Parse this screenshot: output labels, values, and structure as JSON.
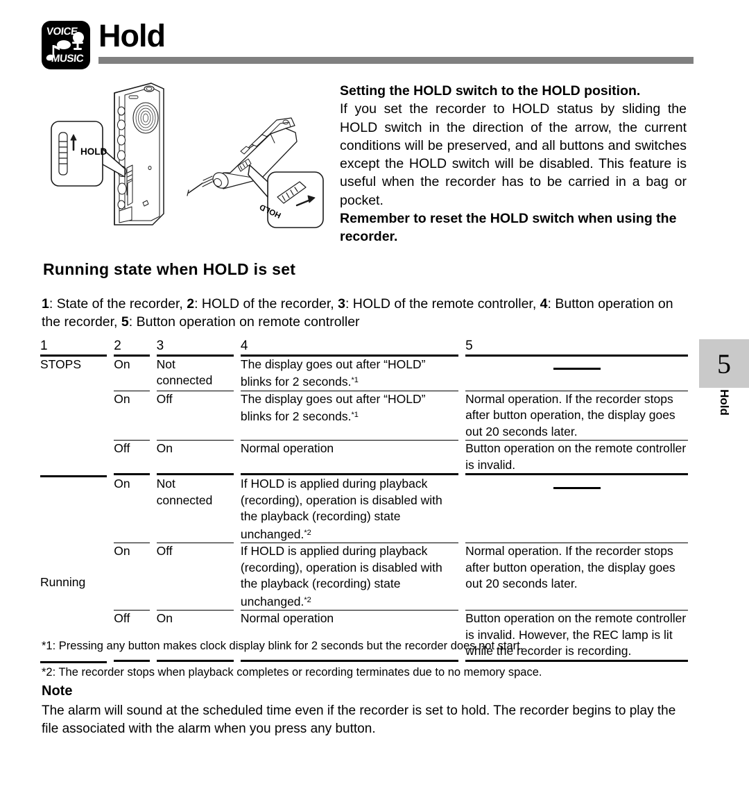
{
  "header": {
    "title": "Hold",
    "logo": {
      "top_text": "VOICE",
      "bottom_text": "MUSIC",
      "icon": "voice-music-logo"
    },
    "rule_color": "#808080"
  },
  "illustration": {
    "recorder_callout_label": "HOLD",
    "remote_callout_label": "HOLD",
    "alt": "IC recorder with HOLD switch callout and remote controller with HOLD switch callout"
  },
  "intro": {
    "heading": "Setting the HOLD switch to the HOLD position.",
    "body": "If you set the recorder to HOLD status by sliding the HOLD switch in the direction of the arrow, the current conditions will be preserved, and all buttons and switches except the HOLD switch will be disabled. This feature is useful when the recorder has to be carried in a bag or pocket.",
    "reminder": "Remember to reset the HOLD switch when using the recorder."
  },
  "section": {
    "heading": "Running state when HOLD is set",
    "legend_parts": [
      {
        "num": "1",
        "text": ": State of the recorder, "
      },
      {
        "num": "2",
        "text": ": HOLD of the recorder, "
      },
      {
        "num": "3",
        "text": ": HOLD of the remote controller, "
      },
      {
        "num": "4",
        "text": ": Button operation on the recorder, "
      },
      {
        "num": "5",
        "text": ": Button operation on remote controller"
      }
    ]
  },
  "table": {
    "headers": [
      "1",
      "2",
      "3",
      "4",
      "5"
    ],
    "groups": [
      {
        "state": "STOPS",
        "rows": [
          {
            "hold_recorder": "On",
            "hold_remote": "Not connected",
            "recorder_op": "The display goes out after “HOLD” blinks for 2 seconds.",
            "recorder_op_note": "*1",
            "remote_op": "",
            "remote_op_dash": true
          },
          {
            "hold_recorder": "On",
            "hold_remote": "Off",
            "recorder_op": "The display goes out after “HOLD” blinks for 2 seconds.",
            "recorder_op_note": "*1",
            "remote_op": "Normal operation. If the recorder stops after button operation, the display goes out 20 seconds later.",
            "remote_op_dash": false
          },
          {
            "hold_recorder": "Off",
            "hold_remote": "On",
            "recorder_op": "Normal operation",
            "recorder_op_note": "",
            "remote_op": "Button operation on the remote controller is invalid.",
            "remote_op_dash": false
          }
        ]
      },
      {
        "state": "Running",
        "rows": [
          {
            "hold_recorder": "On",
            "hold_remote": "Not connected",
            "recorder_op": "If HOLD is applied during playback (recording), operation is disabled with the playback (recording) state unchanged.",
            "recorder_op_note": "*2",
            "remote_op": "",
            "remote_op_dash": true
          },
          {
            "hold_recorder": "On",
            "hold_remote": "Off",
            "recorder_op": "If HOLD is applied during playback (recording), operation is disabled with the playback (recording) state unchanged.",
            "recorder_op_note": "*2",
            "remote_op": "Normal operation. If the recorder stops after button operation, the display goes out 20 seconds later.",
            "remote_op_dash": false
          },
          {
            "hold_recorder": "Off",
            "hold_remote": "On",
            "recorder_op": "Normal operation",
            "recorder_op_note": "",
            "remote_op": "Button operation on the remote controller is invalid. However, the REC lamp is lit while the recorder is recording.",
            "remote_op_dash": false
          }
        ]
      }
    ]
  },
  "footnotes": [
    "*1: Pressing any button makes clock display blink for 2 seconds but the recorder does not start.",
    "*2: The recorder stops when playback completes or recording terminates due to no memory space."
  ],
  "note": {
    "heading": "Note",
    "body": "The alarm will sound at the scheduled time even if the recorder is set to hold. The recorder begins to play the file associated with the alarm when you press any button."
  },
  "side_tab": {
    "number": "5",
    "label": "Hold",
    "background": "#c9c9c9"
  }
}
